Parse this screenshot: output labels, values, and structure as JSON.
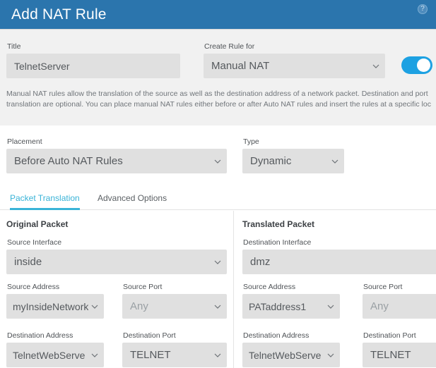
{
  "header": {
    "title": "Add NAT Rule",
    "help_icon": "question-mark-icon",
    "help_glyph": "?",
    "background_color": "#2b75ad"
  },
  "top_section": {
    "title_label": "Title",
    "title_value": "TelnetServer",
    "create_rule_for_label": "Create Rule for",
    "create_rule_for_value": "Manual NAT",
    "enable_toggle_state": "on",
    "toggle_color": "#1da1e2",
    "description": "Manual NAT rules allow the translation of the source as well as the destination address of a network packet. Destination and port translation are optional. You can place manual NAT rules either before or after Auto NAT rules and insert the rules at a specific loc"
  },
  "rule_options": {
    "placement_label": "Placement",
    "placement_value": "Before Auto NAT Rules",
    "type_label": "Type",
    "type_value": "Dynamic"
  },
  "tabs": {
    "active_color": "#39b3d7",
    "items": [
      {
        "label": "Packet Translation",
        "active": true
      },
      {
        "label": "Advanced Options",
        "active": false
      }
    ]
  },
  "original_packet": {
    "section_title": "Original Packet",
    "source_interface_label": "Source Interface",
    "source_interface_value": "inside",
    "source_address_label": "Source Address",
    "source_address_value": "myInsideNetwork",
    "source_port_label": "Source Port",
    "source_port_value": "Any",
    "source_port_is_placeholder": true,
    "destination_address_label": "Destination Address",
    "destination_address_value": "TelnetWebServe",
    "destination_port_label": "Destination Port",
    "destination_port_value": "TELNET"
  },
  "translated_packet": {
    "section_title": "Translated Packet",
    "destination_interface_label": "Destination Interface",
    "destination_interface_value": "dmz",
    "source_address_label": "Source Address",
    "source_address_value": "PATaddress1",
    "source_port_label": "Source Port",
    "source_port_value": "Any",
    "source_port_is_placeholder": true,
    "destination_address_label": "Destination Address",
    "destination_address_value": "TelnetWebServe",
    "destination_port_label": "Destination Port",
    "destination_port_value": "TELNET"
  }
}
